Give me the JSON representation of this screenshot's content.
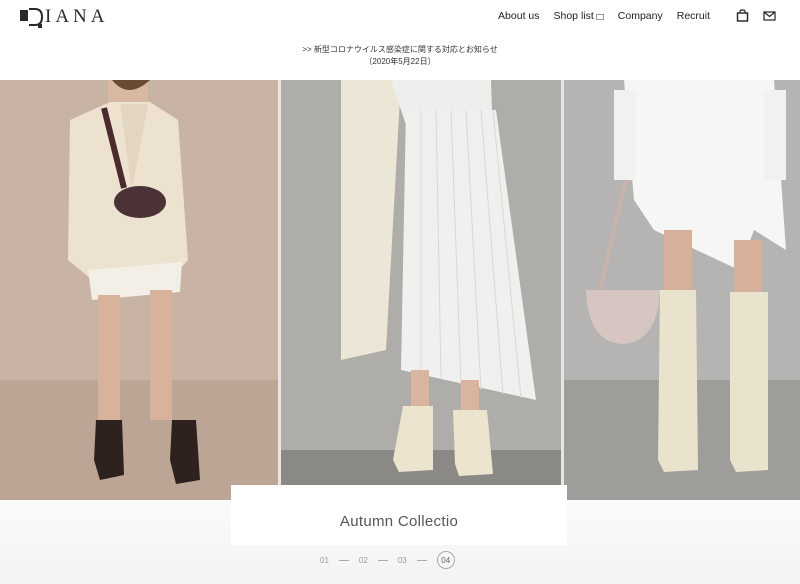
{
  "brand": {
    "logo_text": "IANA"
  },
  "nav": {
    "items": [
      {
        "label": "About us"
      },
      {
        "label": "Shop list"
      },
      {
        "label": "Company"
      },
      {
        "label": "Recruit"
      }
    ]
  },
  "notice": {
    "line1": ">> 新型コロナウイルス感染症に関する対応とお知らせ",
    "line2": "（2020年5月22日）"
  },
  "slider": {
    "caption": "Autumn Collectio",
    "pages": [
      "01",
      "02",
      "03",
      "04"
    ],
    "active_page": "04"
  }
}
